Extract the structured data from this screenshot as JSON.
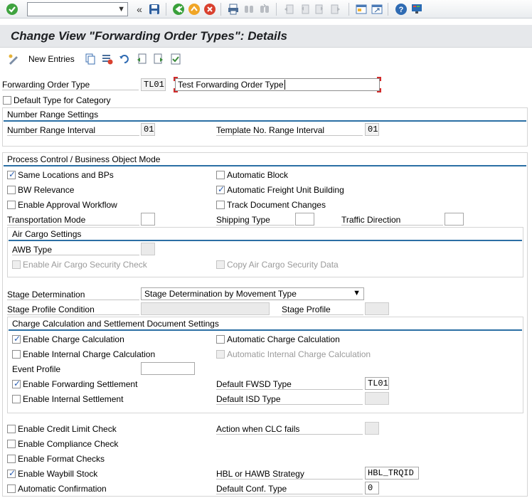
{
  "toolbar": {
    "command_field_value": "",
    "icons": [
      "enter-icon",
      "command-dropdown-icon",
      "expand-icon",
      "save-icon",
      "back-icon",
      "exit-icon",
      "cancel-icon",
      "print-icon",
      "find-icon",
      "find-next-icon",
      "first-page-icon",
      "previous-page-icon",
      "next-page-icon",
      "last-page-icon",
      "create-session-icon",
      "shortcut-icon",
      "help-icon",
      "layout-icon"
    ]
  },
  "title": "Change View \"Forwarding Order Types\": Details",
  "appbar": {
    "new_entries": "New Entries"
  },
  "header": {
    "fwo_type_label": "Forwarding Order Type",
    "fwo_type_value": "TL01",
    "fwo_type_desc": "Test Forwarding Order Type",
    "default_type_label": "Default Type for Category",
    "default_type_checked": false
  },
  "number_range": {
    "title": "Number Range Settings",
    "interval_label": "Number Range Interval",
    "interval_value": "01",
    "template_label": "Template No. Range Interval",
    "template_value": "01"
  },
  "process": {
    "title": "Process Control / Business Object Mode",
    "same_locations": "Same Locations and BPs",
    "same_locations_checked": true,
    "automatic_block": "Automatic Block",
    "automatic_block_checked": false,
    "bw_relevance": "BW Relevance",
    "bw_relevance_checked": false,
    "auto_fu_building": "Automatic Freight Unit Building",
    "auto_fu_building_checked": true,
    "approval_workflow": "Enable Approval Workflow",
    "approval_workflow_checked": false,
    "track_doc_changes": "Track Document Changes",
    "track_doc_changes_checked": false,
    "transport_mode": "Transportation Mode",
    "transport_mode_value": "",
    "shipping_type": "Shipping Type",
    "shipping_type_value": "",
    "traffic_direction": "Traffic Direction",
    "traffic_direction_value": ""
  },
  "air_cargo": {
    "title": "Air Cargo Settings",
    "awb_type": "AWB Type",
    "awb_type_value": "",
    "security_check": "Enable Air Cargo Security Check",
    "copy_security": "Copy Air Cargo Security Data"
  },
  "stage": {
    "determination_label": "Stage Determination",
    "determination_value": "Stage Determination by Movement Type",
    "profile_condition_label": "Stage Profile Condition",
    "profile_condition_value": "",
    "profile_label": "Stage Profile",
    "profile_value": ""
  },
  "charge": {
    "title": "Charge Calculation and Settlement Document Settings",
    "enable_charge": "Enable Charge Calculation",
    "enable_charge_checked": true,
    "auto_charge": "Automatic Charge Calculation",
    "auto_charge_checked": false,
    "internal_charge": "Enable Internal Charge Calculation",
    "internal_charge_checked": false,
    "auto_internal_charge": "Automatic Internal Charge Calculation",
    "event_profile": "Event Profile",
    "event_profile_value": "",
    "fwd_settlement": "Enable Forwarding Settlement",
    "fwd_settlement_checked": true,
    "default_fwsd": "Default FWSD Type",
    "default_fwsd_value": "TL01",
    "internal_settlement": "Enable Internal Settlement",
    "internal_settlement_checked": false,
    "default_isd": "Default ISD Type",
    "default_isd_value": ""
  },
  "bottom": {
    "credit_limit": "Enable Credit Limit Check",
    "credit_limit_checked": false,
    "clc_fails": "Action when CLC fails",
    "clc_fails_value": "",
    "compliance": "Enable Compliance Check",
    "compliance_checked": false,
    "format_checks": "Enable Format Checks",
    "format_checks_checked": false,
    "waybill_stock": "Enable Waybill Stock",
    "waybill_stock_checked": true,
    "hbl_strategy": "HBL or HAWB Strategy",
    "hbl_strategy_value": "HBL_TRQID",
    "auto_confirmation": "Automatic Confirmation",
    "auto_confirmation_checked": false,
    "default_conf_type": "Default Conf. Type",
    "default_conf_type_value": "0"
  },
  "colors": {
    "accent_line": "#2b6fa4",
    "check_mark": "#2a5db0",
    "title_bg": "#e6e8eb"
  }
}
